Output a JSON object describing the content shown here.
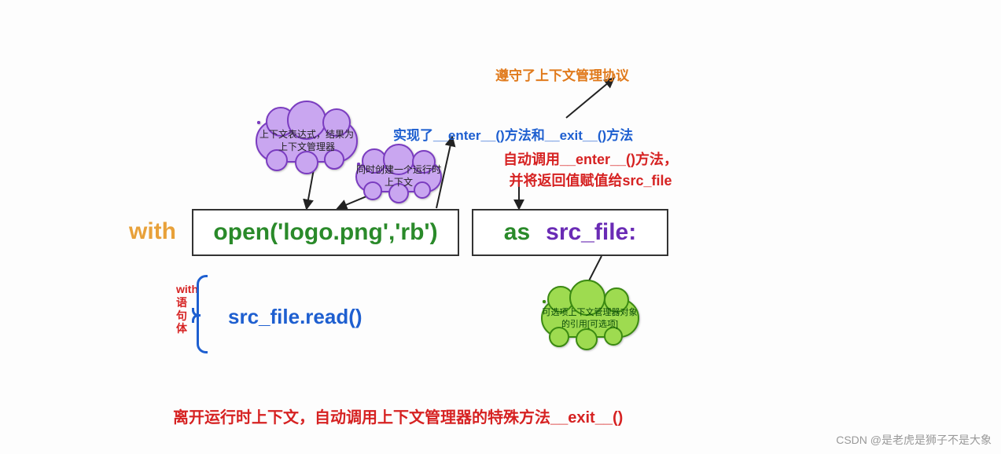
{
  "top_orange": "遵守了上下文管理协议",
  "blue_line": "实现了__enter__()方法和__exit__()方法",
  "red_enter": "自动调用__enter__()方法，\n并将返回值赋值给src_file",
  "cloud1": "上下文表达式，结果为上下文管理器",
  "cloud2": "同时创建一个运行时上下文",
  "cloud3": "可选项上下文管理器对象的引用[可选项]",
  "with_kw": "with",
  "open_call": "open('logo.png','rb')",
  "as_kw": "as",
  "src_file": "src_file:",
  "body_label": "with语句体",
  "body_code": "src_file.read()",
  "footer": "离开运行时上下文，自动调用上下文管理器的特殊方法__exit__()",
  "watermark": "CSDN @是老虎是狮子不是大象"
}
